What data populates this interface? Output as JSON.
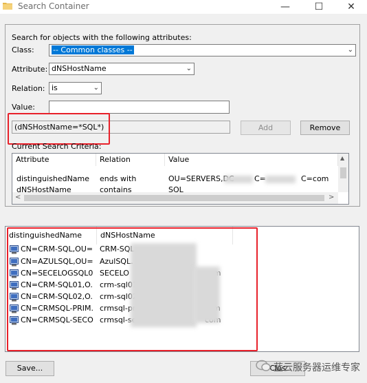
{
  "window": {
    "title": "Search Container",
    "minimize_glyph": "—",
    "maximize_glyph": "☐",
    "close_glyph": "✕"
  },
  "form": {
    "heading": "Search for objects with the following attributes:",
    "class_label": "Class:",
    "class_value": "-- Common classes --",
    "attribute_label": "Attribute:",
    "attribute_value": "dNSHostName",
    "relation_label": "Relation:",
    "relation_value": "is",
    "value_label": "Value:",
    "value_input": "",
    "criteria_preview": "(dNSHostName=*SQL*)",
    "add_label": "Add",
    "remove_label": "Remove",
    "criteria_label": "Current Search Criteria:"
  },
  "criteria_table": {
    "columns": [
      "Attribute",
      "Relation",
      "Value"
    ],
    "rows": [
      {
        "attribute": "distinguishedName",
        "relation": "ends with",
        "value_a": "OU=SERVERS,DC",
        "value_b": "C=",
        "value_c": "C=com"
      },
      {
        "attribute": "dNSHostName",
        "relation": "contains",
        "value_a": "SQL",
        "value_b": "",
        "value_c": ""
      }
    ]
  },
  "results": {
    "columns": [
      "distinguishedName",
      "dNSHostName"
    ],
    "rows": [
      {
        "dn": "CN=CRM-SQL,OU=...",
        "host": "CRM-SQL",
        "host_tail": ""
      },
      {
        "dn": "CN=AZULSQL,OU=...",
        "host": "AzulSQL.",
        "host_tail": ""
      },
      {
        "dn": "CN=SECELOGSQL0...",
        "host": "SECELO",
        "host_tail": "om"
      },
      {
        "dn": "CN=CRM-SQL01,O...",
        "host": "crm-sql01",
        "host_tail": ""
      },
      {
        "dn": "CN=CRM-SQL02,O...",
        "host": "crm-sql02",
        "host_tail": ""
      },
      {
        "dn": "CN=CRMSQL-PRIM...",
        "host": "crmsql-pri",
        "host_tail": "m"
      },
      {
        "dn": "CN=CRMSQL-SECO...",
        "host": "crmsql-sec",
        "host_tail": "com"
      }
    ]
  },
  "footer": {
    "save_label": "Save...",
    "watermark": "蓝云服务器运维专家",
    "clipped_button_label": "Clos"
  },
  "colors": {
    "selection": "#0078d7",
    "highlight_box": "#e8202a"
  }
}
